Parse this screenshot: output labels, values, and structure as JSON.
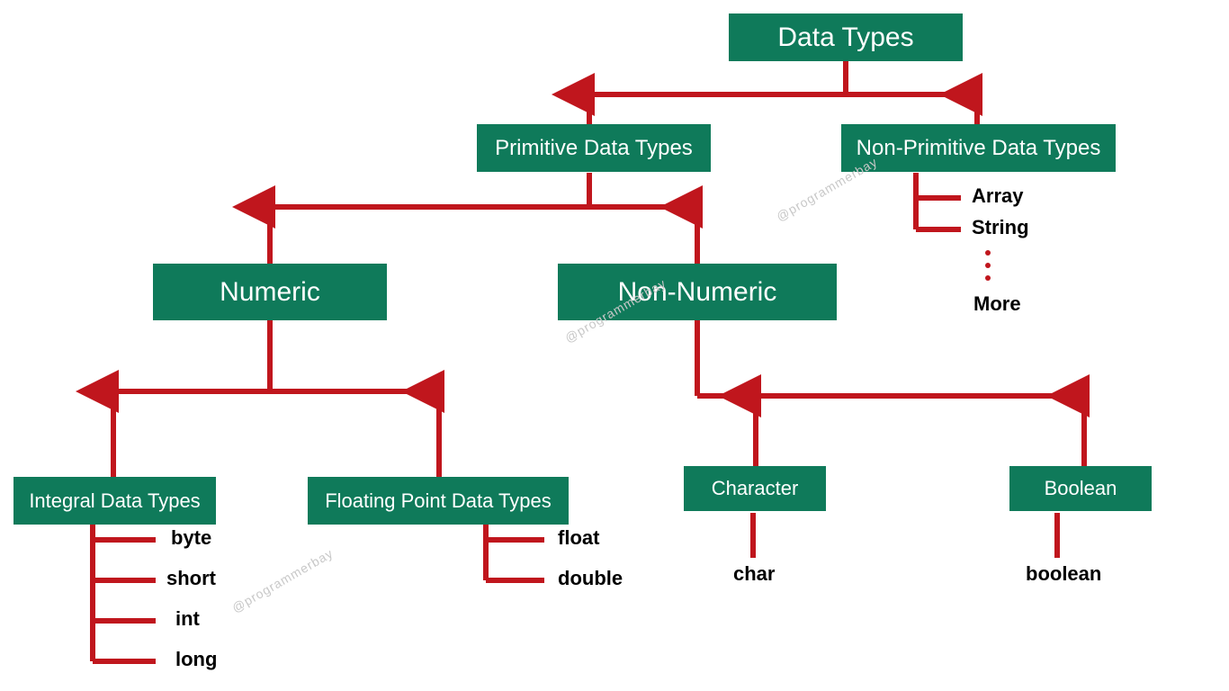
{
  "colors": {
    "box": "#0f7a5a",
    "line": "#c0161d",
    "text_dark": "#000000"
  },
  "watermark": "@programmerbay",
  "nodes": {
    "root": "Data Types",
    "primitive": "Primitive Data Types",
    "nonprimitive": "Non-Primitive Data Types",
    "numeric": "Numeric",
    "nonnumeric": "Non-Numeric",
    "integral": "Integral Data Types",
    "floating": "Floating Point Data Types",
    "character": "Character",
    "boolean": "Boolean"
  },
  "leaves": {
    "nonprimitive": [
      "Array",
      "String"
    ],
    "nonprimitive_more": "More",
    "integral": [
      "byte",
      "short",
      "int",
      "long"
    ],
    "floating": [
      "float",
      "double"
    ],
    "character": [
      "char"
    ],
    "boolean": [
      "boolean"
    ]
  }
}
